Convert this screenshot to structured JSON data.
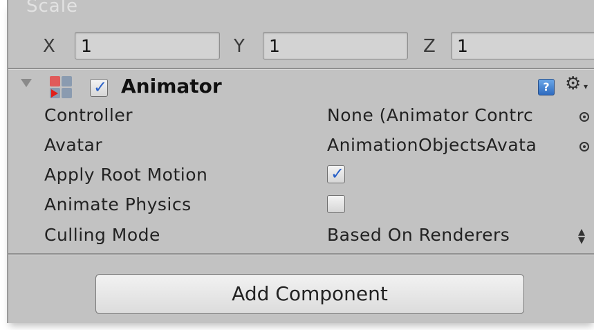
{
  "transform": {
    "scale_label": "Scale",
    "axes": [
      {
        "label": "X",
        "value": "1"
      },
      {
        "label": "Y",
        "value": "1"
      },
      {
        "label": "Z",
        "value": "1"
      }
    ]
  },
  "animator": {
    "title": "Animator",
    "enabled": true,
    "help_icon": "?",
    "gear_icon": "⚙",
    "gear_caret": "▾",
    "properties": [
      {
        "label": "Controller",
        "value": "None (Animator Contrc"
      },
      {
        "label": "Avatar",
        "value": "AnimationObjectsAvata"
      },
      {
        "label": "Apply Root Motion",
        "checked": true
      },
      {
        "label": "Animate Physics",
        "checked": false
      },
      {
        "label": "Culling Mode",
        "value": "Based On Renderers"
      }
    ]
  },
  "add_component_label": "Add Component",
  "colors": {
    "panel_bg": "#c2c2c2",
    "checkbox_tick": "#2b62c8",
    "help_icon_blue": "#2f6bc0"
  }
}
